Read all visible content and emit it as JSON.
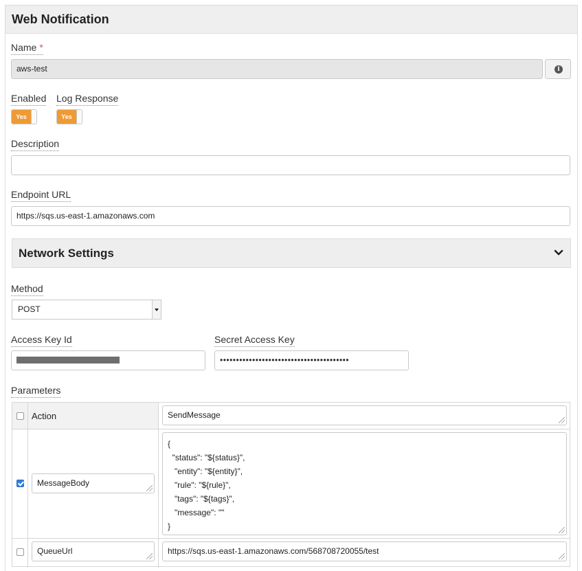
{
  "header": {
    "title": "Web Notification"
  },
  "fields": {
    "name": {
      "label": "Name",
      "required_mark": "*",
      "value": "aws-test"
    },
    "enabled": {
      "label": "Enabled",
      "toggle": "Yes"
    },
    "log_response": {
      "label": "Log Response",
      "toggle": "Yes"
    },
    "description": {
      "label": "Description",
      "value": ""
    },
    "endpoint_url": {
      "label": "Endpoint URL",
      "value": "https://sqs.us-east-1.amazonaws.com"
    }
  },
  "network": {
    "title": "Network Settings",
    "method": {
      "label": "Method",
      "value": "POST"
    },
    "access_key": {
      "label": "Access Key Id"
    },
    "secret_key": {
      "label": "Secret Access Key",
      "value": "••••••••••••••••••••••••••••••••••••••••"
    }
  },
  "parameters": {
    "label": "Parameters",
    "header_name": "Action",
    "header_value": "SendMessage",
    "rows": [
      {
        "name": "MessageBody",
        "checked": true,
        "value_lines": [
          "{",
          "  \"status\": \"${status}\",",
          "   \"entity\": \"${entity}\",",
          "   \"rule\": \"${rule}\",",
          "   \"tags\": \"${tags}\",",
          "   \"message\": \"\"",
          "}"
        ]
      },
      {
        "name": "QueueUrl",
        "checked": false,
        "value": "https://sqs.us-east-1.amazonaws.com/568708720055/test"
      }
    ]
  },
  "icons": {
    "info": "info-icon",
    "collapse": "chevron-down-icon"
  },
  "colors": {
    "toggle_on": "#ef9a35",
    "required": "#d9534f",
    "checkbox_checked": "#2f7fe0"
  }
}
